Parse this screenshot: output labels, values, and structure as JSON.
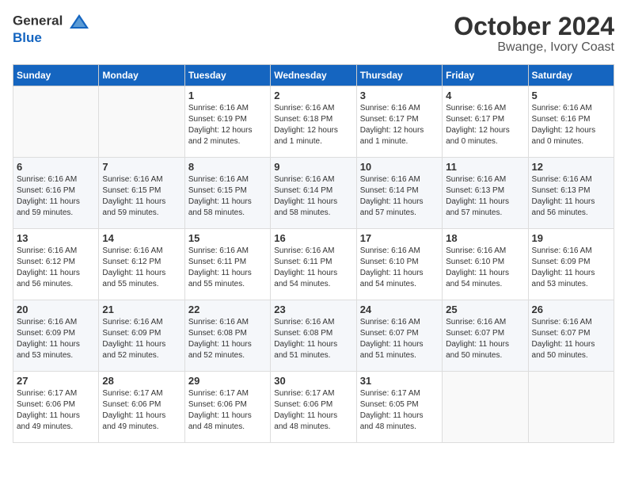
{
  "logo": {
    "line1": "General",
    "line2": "Blue"
  },
  "title": "October 2024",
  "subtitle": "Bwange, Ivory Coast",
  "days_of_week": [
    "Sunday",
    "Monday",
    "Tuesday",
    "Wednesday",
    "Thursday",
    "Friday",
    "Saturday"
  ],
  "weeks": [
    [
      {
        "day": "",
        "detail": ""
      },
      {
        "day": "",
        "detail": ""
      },
      {
        "day": "1",
        "detail": "Sunrise: 6:16 AM\nSunset: 6:19 PM\nDaylight: 12 hours\nand 2 minutes."
      },
      {
        "day": "2",
        "detail": "Sunrise: 6:16 AM\nSunset: 6:18 PM\nDaylight: 12 hours\nand 1 minute."
      },
      {
        "day": "3",
        "detail": "Sunrise: 6:16 AM\nSunset: 6:17 PM\nDaylight: 12 hours\nand 1 minute."
      },
      {
        "day": "4",
        "detail": "Sunrise: 6:16 AM\nSunset: 6:17 PM\nDaylight: 12 hours\nand 0 minutes."
      },
      {
        "day": "5",
        "detail": "Sunrise: 6:16 AM\nSunset: 6:16 PM\nDaylight: 12 hours\nand 0 minutes."
      }
    ],
    [
      {
        "day": "6",
        "detail": "Sunrise: 6:16 AM\nSunset: 6:16 PM\nDaylight: 11 hours\nand 59 minutes."
      },
      {
        "day": "7",
        "detail": "Sunrise: 6:16 AM\nSunset: 6:15 PM\nDaylight: 11 hours\nand 59 minutes."
      },
      {
        "day": "8",
        "detail": "Sunrise: 6:16 AM\nSunset: 6:15 PM\nDaylight: 11 hours\nand 58 minutes."
      },
      {
        "day": "9",
        "detail": "Sunrise: 6:16 AM\nSunset: 6:14 PM\nDaylight: 11 hours\nand 58 minutes."
      },
      {
        "day": "10",
        "detail": "Sunrise: 6:16 AM\nSunset: 6:14 PM\nDaylight: 11 hours\nand 57 minutes."
      },
      {
        "day": "11",
        "detail": "Sunrise: 6:16 AM\nSunset: 6:13 PM\nDaylight: 11 hours\nand 57 minutes."
      },
      {
        "day": "12",
        "detail": "Sunrise: 6:16 AM\nSunset: 6:13 PM\nDaylight: 11 hours\nand 56 minutes."
      }
    ],
    [
      {
        "day": "13",
        "detail": "Sunrise: 6:16 AM\nSunset: 6:12 PM\nDaylight: 11 hours\nand 56 minutes."
      },
      {
        "day": "14",
        "detail": "Sunrise: 6:16 AM\nSunset: 6:12 PM\nDaylight: 11 hours\nand 55 minutes."
      },
      {
        "day": "15",
        "detail": "Sunrise: 6:16 AM\nSunset: 6:11 PM\nDaylight: 11 hours\nand 55 minutes."
      },
      {
        "day": "16",
        "detail": "Sunrise: 6:16 AM\nSunset: 6:11 PM\nDaylight: 11 hours\nand 54 minutes."
      },
      {
        "day": "17",
        "detail": "Sunrise: 6:16 AM\nSunset: 6:10 PM\nDaylight: 11 hours\nand 54 minutes."
      },
      {
        "day": "18",
        "detail": "Sunrise: 6:16 AM\nSunset: 6:10 PM\nDaylight: 11 hours\nand 54 minutes."
      },
      {
        "day": "19",
        "detail": "Sunrise: 6:16 AM\nSunset: 6:09 PM\nDaylight: 11 hours\nand 53 minutes."
      }
    ],
    [
      {
        "day": "20",
        "detail": "Sunrise: 6:16 AM\nSunset: 6:09 PM\nDaylight: 11 hours\nand 53 minutes."
      },
      {
        "day": "21",
        "detail": "Sunrise: 6:16 AM\nSunset: 6:09 PM\nDaylight: 11 hours\nand 52 minutes."
      },
      {
        "day": "22",
        "detail": "Sunrise: 6:16 AM\nSunset: 6:08 PM\nDaylight: 11 hours\nand 52 minutes."
      },
      {
        "day": "23",
        "detail": "Sunrise: 6:16 AM\nSunset: 6:08 PM\nDaylight: 11 hours\nand 51 minutes."
      },
      {
        "day": "24",
        "detail": "Sunrise: 6:16 AM\nSunset: 6:07 PM\nDaylight: 11 hours\nand 51 minutes."
      },
      {
        "day": "25",
        "detail": "Sunrise: 6:16 AM\nSunset: 6:07 PM\nDaylight: 11 hours\nand 50 minutes."
      },
      {
        "day": "26",
        "detail": "Sunrise: 6:16 AM\nSunset: 6:07 PM\nDaylight: 11 hours\nand 50 minutes."
      }
    ],
    [
      {
        "day": "27",
        "detail": "Sunrise: 6:17 AM\nSunset: 6:06 PM\nDaylight: 11 hours\nand 49 minutes."
      },
      {
        "day": "28",
        "detail": "Sunrise: 6:17 AM\nSunset: 6:06 PM\nDaylight: 11 hours\nand 49 minutes."
      },
      {
        "day": "29",
        "detail": "Sunrise: 6:17 AM\nSunset: 6:06 PM\nDaylight: 11 hours\nand 48 minutes."
      },
      {
        "day": "30",
        "detail": "Sunrise: 6:17 AM\nSunset: 6:06 PM\nDaylight: 11 hours\nand 48 minutes."
      },
      {
        "day": "31",
        "detail": "Sunrise: 6:17 AM\nSunset: 6:05 PM\nDaylight: 11 hours\nand 48 minutes."
      },
      {
        "day": "",
        "detail": ""
      },
      {
        "day": "",
        "detail": ""
      }
    ]
  ]
}
